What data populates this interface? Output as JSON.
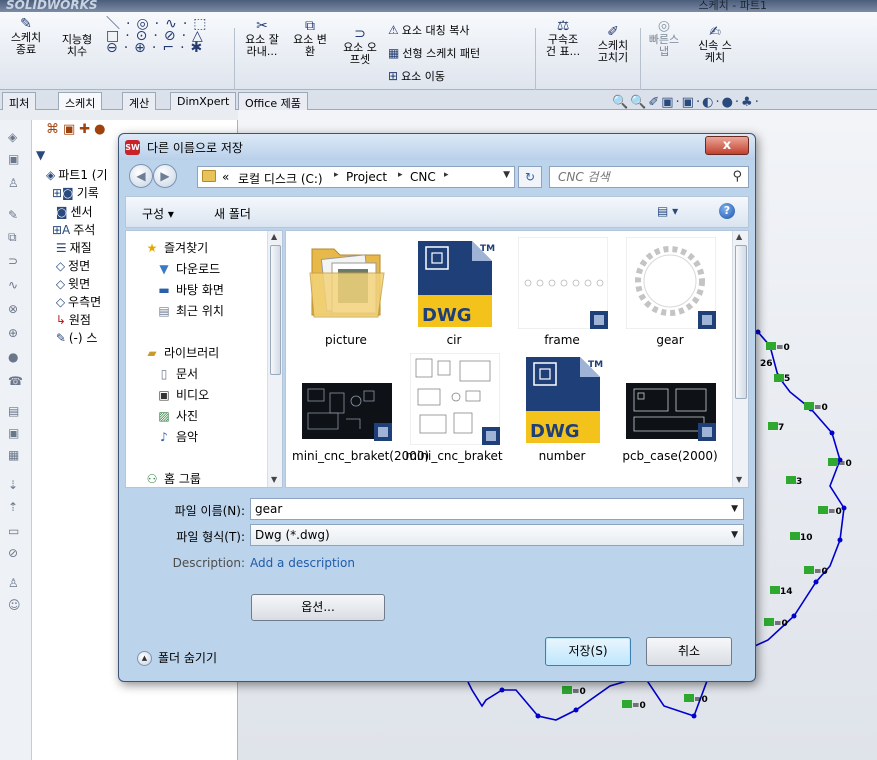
{
  "app": {
    "brand": "SOLIDWORKS",
    "window_title": "스케치 - 파트1",
    "ribbon": {
      "sketch_exit": "스케치\n종료",
      "smart_dim": "지능형\n치수",
      "trim": "요소 잘\n라내...",
      "convert": "요소 변\n환",
      "offset": "요소 오\n프셋",
      "mirror": "요소 대칭 복사",
      "linear_pattern": "선형 스케치 패턴",
      "move": "요소 이동",
      "relations": "구속조\n건 표...",
      "repair": "스케치\n고치기",
      "quick_snap": "빠른스\n냅",
      "rapid_sketch": "신속 스\n케치"
    },
    "tabs": [
      "피처",
      "스케치",
      "계산",
      "DimXpert",
      "Office 제품"
    ],
    "tree": [
      "파트1 (기",
      "기록",
      "센서",
      "주석",
      "재질",
      "정면",
      "윗면",
      "우측면",
      "원점",
      "(-) 스"
    ],
    "canvas_labels": [
      "26",
      "5",
      "7",
      "3",
      "10",
      "14"
    ]
  },
  "dialog": {
    "title": "다른 이름으로 저장",
    "close_label": "x",
    "address": {
      "prefix": "«",
      "crumbs": [
        "로컬 디스크 (C:)",
        "Project",
        "CNC"
      ]
    },
    "search_placeholder": "CNC 검색",
    "toolbar": {
      "organize": "구성 ▾",
      "new_folder": "새 폴더"
    },
    "nav": {
      "favorites": "즐겨찾기",
      "downloads": "다운로드",
      "desktop": "바탕 화면",
      "recent": "최근 위치",
      "libraries": "라이브러리",
      "documents": "문서",
      "videos": "비디오",
      "pictures": "사진",
      "music": "음악",
      "homegroup": "홈 그룹"
    },
    "files": [
      {
        "name": "picture",
        "kind": "folder"
      },
      {
        "name": "cir",
        "kind": "dwg"
      },
      {
        "name": "frame",
        "kind": "drawing-frame"
      },
      {
        "name": "gear",
        "kind": "drawing-gear"
      },
      {
        "name": "mini_cnc_braket(2000)",
        "kind": "drawing-dark"
      },
      {
        "name": "mini_cnc_braket",
        "kind": "drawing-light"
      },
      {
        "name": "number",
        "kind": "dwg"
      },
      {
        "name": "pcb_case(2000)",
        "kind": "drawing-dark"
      }
    ],
    "dwg_badge": "DWG",
    "tm_mark": "TM",
    "filename_label": "파일 이름(N):",
    "filename_value": "gear",
    "filetype_label": "파일 형식(T):",
    "filetype_value": "Dwg (*.dwg)",
    "description_label": "Description:",
    "description_link": "Add a description",
    "options_label": "옵션...",
    "hide_folders": "폴더 숨기기",
    "save_label": "저장(S)",
    "cancel_label": "취소"
  },
  "colors": {
    "dialog_frame": "#bcd3ec",
    "sketch_line": "#0000cc",
    "dwg_yellow": "#f3c31c",
    "dwg_blue": "#1f3f78"
  }
}
